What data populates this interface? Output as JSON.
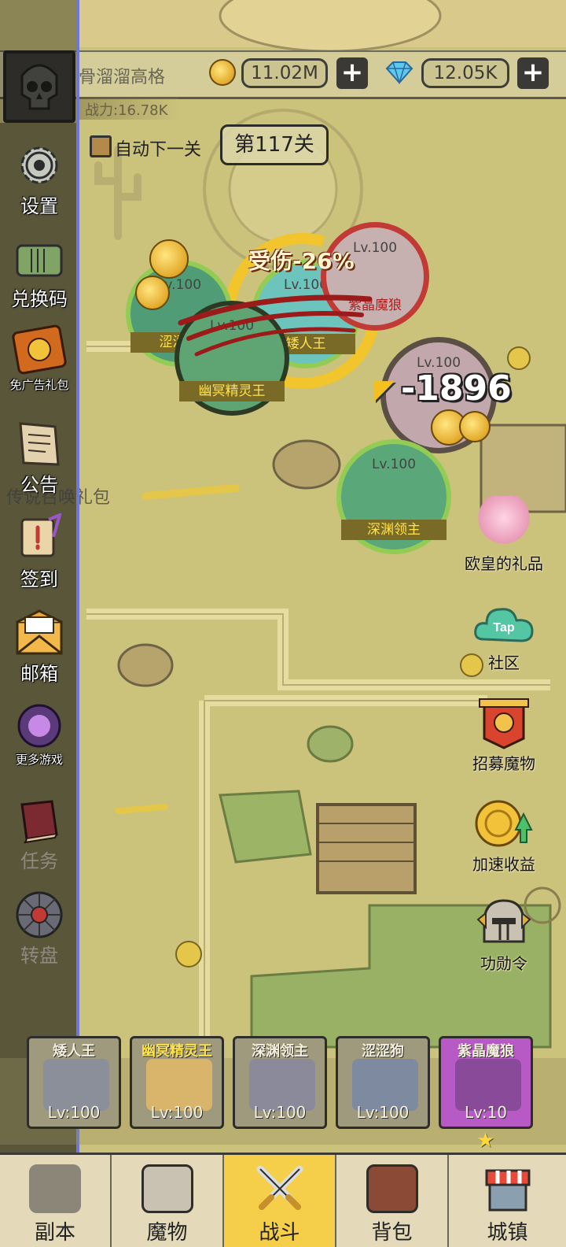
{
  "player": {
    "name": "骨溜溜高格",
    "power": "战力:16.78K"
  },
  "currency": {
    "gold": "11.02M",
    "diamonds": "12.05K",
    "plus_symbol": "+"
  },
  "stage": {
    "auto_next_label": "自动下一关",
    "current": "第117关"
  },
  "left_menu": {
    "settings": "设置",
    "redeem": "兑换码",
    "ad_free_pack": "免广告礼包",
    "notice": "公告",
    "signin": "签到",
    "mail": "邮箱",
    "more_games": "更多游戏",
    "tasks": "任务",
    "wheel": "转盘",
    "ghost_pack": "传说召唤礼包"
  },
  "battle": {
    "monsters": [
      {
        "name": "涩涩狗",
        "level": "Lv.100"
      },
      {
        "name": "幽冥精灵王",
        "level": "Lv.100"
      },
      {
        "name": "矮人王",
        "level": "Lv.100"
      },
      {
        "name": "紫晶魔狼",
        "level": "Lv.100"
      },
      {
        "name": "",
        "level": "Lv.100"
      },
      {
        "name": "深渊领主",
        "level": "Lv.100"
      }
    ],
    "damage_text": "-1896",
    "debuff_text": "受伤-26%"
  },
  "right_menu": {
    "lucky_gift": "欧皇的礼品",
    "community": "社区",
    "tap_label": "Tap",
    "recruit": "招募魔物",
    "speed_up": "加速收益",
    "merit_order": "功勋令"
  },
  "team": [
    {
      "name": "矮人王",
      "level": "Lv:100"
    },
    {
      "name": "幽冥精灵王",
      "level": "Lv:100"
    },
    {
      "name": "深渊领主",
      "level": "Lv:100"
    },
    {
      "name": "涩涩狗",
      "level": "Lv:100"
    },
    {
      "name": "紫晶魔狼",
      "level": "Lv:10"
    }
  ],
  "bottom_nav": {
    "dungeon": "副本",
    "monsters": "魔物",
    "battle": "战斗",
    "bag": "背包",
    "town": "城镇"
  },
  "colors": {
    "map_bg": "#cbc27c",
    "active_tab": "#f5cf4a",
    "accent_blue_line": "#6f78d8",
    "monster_green_ring": "#5aa94a",
    "monster_red_ring": "#c23a35"
  }
}
